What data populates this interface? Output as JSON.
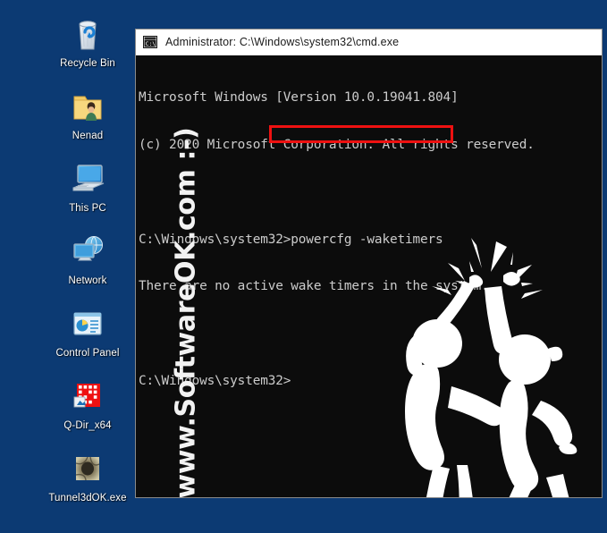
{
  "desktop": {
    "background_color": "#0c3a73",
    "icons": [
      {
        "label": "Recycle Bin",
        "icon": "recycle-bin-icon"
      },
      {
        "label": "Nenad",
        "icon": "user-folder-icon"
      },
      {
        "label": "This PC",
        "icon": "this-pc-icon"
      },
      {
        "label": "Network",
        "icon": "network-icon"
      },
      {
        "label": "Control Panel",
        "icon": "control-panel-icon"
      },
      {
        "label": "Q-Dir_x64",
        "icon": "q-dir-icon"
      },
      {
        "label": "Tunnel3dOK.exe",
        "icon": "tunnel3dok-icon"
      }
    ]
  },
  "cmd_window": {
    "title": "Administrator: C:\\Windows\\system32\\cmd.exe",
    "title_icon": "cmd-console-icon",
    "titlebar_background": "#ffffff",
    "console_background": "#0c0c0c",
    "console_text_color": "#cccccc",
    "lines": [
      "Microsoft Windows [Version 10.0.19041.804]",
      "(c) 2020 Microsoft Corporation. All rights reserved.",
      "",
      "C:\\Windows\\system32>powercfg -waketimers",
      "There are no active wake timers in the system.",
      "",
      "C:\\Windows\\system32>"
    ],
    "highlight": {
      "command": "powercfg -waketimers",
      "color": "#ee1111"
    },
    "watermark": "www.SoftwareOK.com :-)",
    "artwork": "high-five-figures"
  }
}
